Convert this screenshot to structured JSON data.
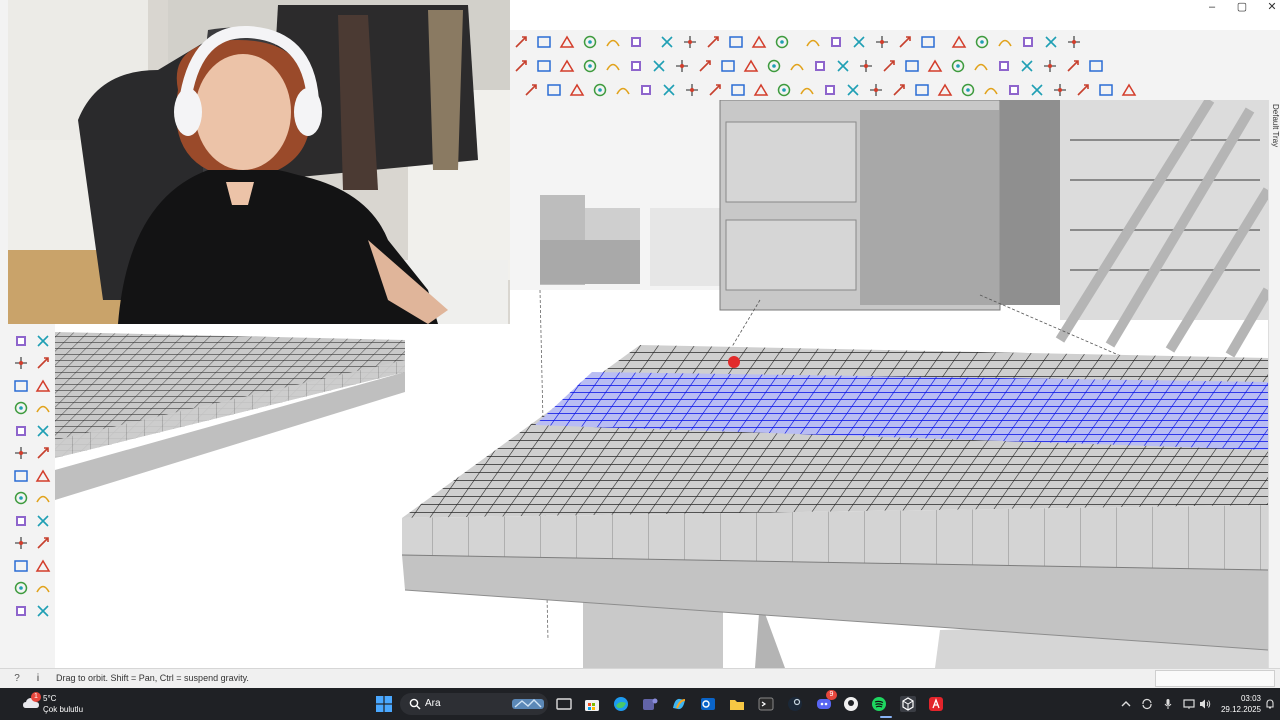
{
  "window": {
    "controls": {
      "minimize": "–",
      "maximize": "▢",
      "close": "✕"
    },
    "tray_label": "Default Tray"
  },
  "toolbars": {
    "row1": [
      "section-plane-icon",
      "section-cuts-icon",
      "component-options-icon",
      "new-file-icon",
      "user-icon",
      "paint-roller-icon",
      "scale-icon",
      "push-pull-red-icon",
      "follow-me-icon",
      "offset-icon",
      "surface-icon",
      "sandbox-icon",
      "group-icon",
      "component-icon",
      "layer-icon",
      "copy-icon",
      "array-icon",
      "house-icon",
      "cube-icon",
      "house-outline-icon",
      "building-icon",
      "panel-icon",
      "wall-icon",
      "door-icon"
    ],
    "row2": [
      "warning-icon",
      "lasso-icon",
      "paint-bucket-icon",
      "rotate-icon",
      "move-icon",
      "box-icon",
      "undo-icon",
      "select-green-icon",
      "material-icon",
      "solid-icon",
      "paint-icon",
      "grid-icon",
      "terrain-icon",
      "table-icon",
      "mesh-icon",
      "tile-yellow-icon",
      "tile-orange-icon",
      "explode-icon",
      "curve-icon",
      "cut-icon",
      "sketch-icon",
      "intersect-icon",
      "split-icon",
      "bezier-icon",
      "polyline-icon",
      "rect-red-icon"
    ],
    "row3": [
      "line-icon",
      "freehand-icon",
      "arc-icon",
      "spline-icon",
      "polygon-icon",
      "rectangle-icon",
      "circle-icon",
      "arc2-icon",
      "pen-icon",
      "arc3-icon",
      "pie-icon",
      "wave-icon",
      "ring-icon",
      "wrench-icon",
      "ellipse-icon",
      "arc4-icon",
      "tool-a-icon",
      "tool-b-icon",
      "tool-c-icon",
      "tool-d-icon",
      "tool-e-icon",
      "tool-f-icon",
      "tool-g-icon",
      "tool-h-icon",
      "tool-i-icon",
      "tool-j-icon",
      "tool-k-icon"
    ],
    "left": [
      "select-icon",
      "eraser-icon",
      "paint-icon",
      "tape-icon",
      "move-icon",
      "rotate-icon",
      "pushpull-icon",
      "scale-icon",
      "pencil-icon",
      "text-icon",
      "orbit-icon",
      "axes-icon",
      "section-icon",
      "walk-icon",
      "zoom-icon",
      "zoom-window-icon",
      "zoom-extents-icon",
      "previous-view-icon",
      "position-camera-icon",
      "walk-person-icon",
      "look-around-icon",
      "section-plane-icon",
      "solid-union-icon",
      "solid-subtract-icon",
      "trim-icon",
      "split-icon"
    ]
  },
  "status": {
    "help_glyph": "?",
    "info_glyph": "i",
    "message": "Drag to orbit. Shift = Pan, Ctrl = suspend gravity."
  },
  "taskbar": {
    "weather": {
      "temperature": "5°C",
      "description": "Çok bulutlu",
      "badge": "1"
    },
    "search_label": "Ara",
    "apps": [
      "windows-start-icon",
      "search-icon",
      "task-view-icon",
      "store-icon",
      "edge-icon",
      "teams-icon",
      "copilot-icon",
      "outlook-icon",
      "file-explorer-icon",
      "terminal-icon",
      "steam-icon",
      "discord-icon",
      "github-icon",
      "spotify-icon",
      "sketchup-icon",
      "acrobat-icon"
    ],
    "discord_badge": "9",
    "tray": {
      "time": "03:03",
      "date": "29.12.2025"
    }
  },
  "colors": {
    "selection_blue": "#0a14e6",
    "taskbar": "#1f2125",
    "spotify": "#1ed760",
    "edge": "#1d9bf0"
  }
}
